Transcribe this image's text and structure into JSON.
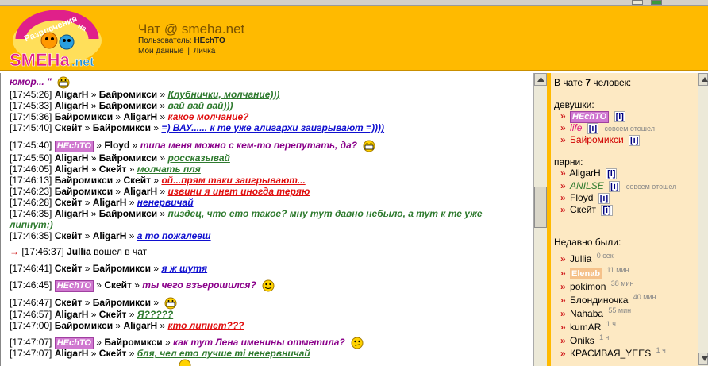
{
  "header": {
    "logo_text": "Развлечения на SMEHa.net",
    "title": "Чат @ smeha.net",
    "user_label": "Пользователь:",
    "user_name": "HEchTO",
    "link_my_data": "Мои данные",
    "link_separator": "|",
    "link_private": "Личка"
  },
  "chat": {
    "top_fragment": "юмор... \"",
    "arrow": "»",
    "lines": [
      {
        "time": "[17:45:26]",
        "from": "AligarH",
        "to": "Байромикси",
        "text": "Клубнички, молчание)))",
        "color": "green"
      },
      {
        "time": "[17:45:33]",
        "from": "AligarH",
        "to": "Байромикси",
        "text": "вай вай вай)))",
        "color": "green"
      },
      {
        "time": "[17:45:36]",
        "from": "Байромикси",
        "to": "AligarH",
        "text": "какое молчание?",
        "color": "red"
      },
      {
        "time": "[17:45:40]",
        "from": "Скейт",
        "to": "Байромикси",
        "text": "=) ВАУ...... к те уже алигархи заигрывают =))))",
        "color": "blue"
      },
      {
        "time": "[17:45:40]",
        "from": "HEchTO",
        "to": "Floyd",
        "text": "типа меня можно с кем-то перепутать, да?",
        "color": "purple"
      },
      {
        "time": "[17:45:50]",
        "from": "AligarH",
        "to": "Байромикси",
        "text": "россказывай",
        "color": "green"
      },
      {
        "time": "[17:46:05]",
        "from": "AligarH",
        "to": "Скейт",
        "text": "молчать пля",
        "color": "green"
      },
      {
        "time": "[17:46:13]",
        "from": "Байромикси",
        "to": "Скейт",
        "text": "ой...прям таки заигрывают...",
        "color": "red"
      },
      {
        "time": "[17:46:23]",
        "from": "Байромикси",
        "to": "AligarH",
        "text": "извини я инет иногда теряю",
        "color": "red"
      },
      {
        "time": "[17:46:28]",
        "from": "Скейт",
        "to": "AligarH",
        "text": "ненервичай",
        "color": "blue"
      },
      {
        "time": "[17:46:35]",
        "from": "AligarH",
        "to": "Байромикси",
        "text": "пиздец, что ето такое? мну тут давно небыло, а тут к те уже",
        "color": "green"
      },
      {
        "time": "",
        "from": "",
        "to": "",
        "text": "липнут;)",
        "color": "green"
      },
      {
        "time": "[17:46:35]",
        "from": "Скейт",
        "to": "AligarH",
        "text": "а то пожалееш",
        "color": "blue"
      },
      {
        "time": "[17:46:37]",
        "from": "Jullia",
        "to": "",
        "text": "вошел в чат",
        "color": "plain"
      },
      {
        "time": "[17:46:41]",
        "from": "Скейт",
        "to": "Байромикси",
        "text": "я ж шутя",
        "color": "blue"
      },
      {
        "time": "[17:46:45]",
        "from": "HEchTO",
        "to": "Скейт",
        "text": "ты чего взъерошился?",
        "color": "purple"
      },
      {
        "time": "[17:46:47]",
        "from": "Скейт",
        "to": "Байромикси",
        "text": "",
        "color": "plain"
      },
      {
        "time": "[17:46:57]",
        "from": "AligarH",
        "to": "Скейт",
        "text": "Я?????",
        "color": "green"
      },
      {
        "time": "[17:47:00]",
        "from": "Байромикси",
        "to": "AligarH",
        "text": "кто липнет???",
        "color": "red"
      },
      {
        "time": "[17:47:07]",
        "from": "HEchTO",
        "to": "Байромикси",
        "text": "как тут Лена именины отметила?",
        "color": "purple"
      },
      {
        "time": "[17:47:07]",
        "from": "AligarH",
        "to": "Скейт",
        "text": "бля, чел ето лучше ті ненервничай",
        "color": "green"
      }
    ]
  },
  "users": {
    "in_chat_prefix": "В чате",
    "count": "7",
    "in_chat_suffix": "человек:",
    "girls_label": "девушки:",
    "boys_label": "парни:",
    "recent_label": "Недавно были:",
    "info_label": "[i]",
    "arrow": "»",
    "girls": [
      {
        "name": "HEchTO",
        "note": ""
      },
      {
        "name": "life",
        "note": "совсем отошел"
      },
      {
        "name": "Байромикси",
        "note": ""
      }
    ],
    "boys": [
      {
        "name": "AligarH",
        "note": ""
      },
      {
        "name": "ANILSE",
        "note": "совсем отошел"
      },
      {
        "name": "Floyd",
        "note": ""
      },
      {
        "name": "Скейт",
        "note": ""
      }
    ],
    "recent": [
      {
        "name": "Jullia",
        "ago": "0 сек"
      },
      {
        "name": "Elenab",
        "ago": "11 мин"
      },
      {
        "name": "pokimon",
        "ago": "38 мин"
      },
      {
        "name": "Блондиночка",
        "ago": "40 мин"
      },
      {
        "name": "Nahaba",
        "ago": "55 мин"
      },
      {
        "name": "kumAR",
        "ago": "1 ч"
      },
      {
        "name": "Oniks",
        "ago": "1 ч"
      },
      {
        "name": "КРАСИВАЯ_YEES",
        "ago": "1 ч"
      }
    ]
  },
  "colors": {
    "header_bg": "#ffba00",
    "panel_bg": "#fde9c3",
    "green_msg": "#2e7a2e",
    "red_msg": "#e01010",
    "blue_msg": "#1010d0",
    "purple_msg": "#8a008a",
    "hecto_badge": "#d078d0"
  }
}
